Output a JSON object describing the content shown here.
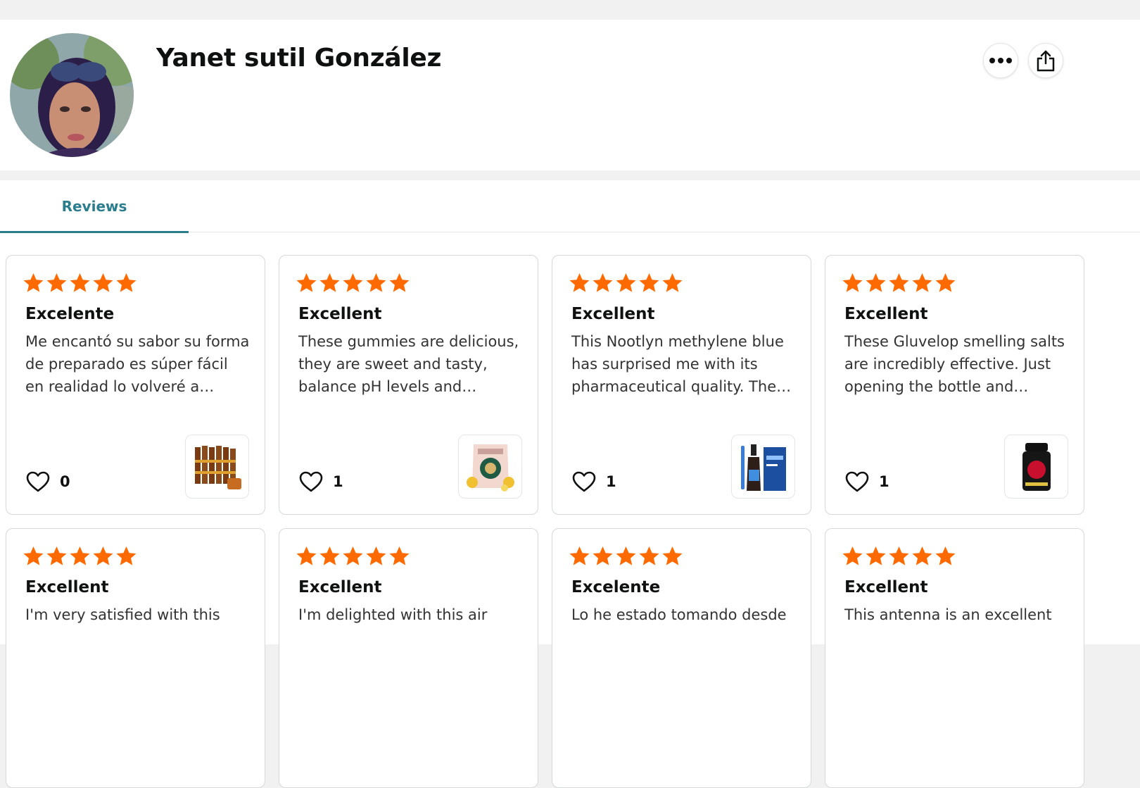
{
  "profile": {
    "name": "Yanet sutil González"
  },
  "tabs": [
    {
      "label": "Reviews"
    }
  ],
  "colors": {
    "accent": "#2a7d8c",
    "star": "#ff6a00"
  },
  "reviews": [
    {
      "rating": 5,
      "title": "Excelente",
      "body": "Me encantó su sabor su forma de preparado es súper fácil en realidad lo volveré a comprar",
      "likes": "0",
      "product_icon": "packets-box-image"
    },
    {
      "rating": 5,
      "title": "Excellent",
      "body": "These gummies are delicious, they are sweet and tasty, balance pH levels and…",
      "likes": "1",
      "product_icon": "gummies-pouch-image"
    },
    {
      "rating": 5,
      "title": "Excellent",
      "body": "This Nootlyn methylene blue has surprised me with its pharmaceutical quality. The…",
      "likes": "1",
      "product_icon": "dropper-bottle-image"
    },
    {
      "rating": 5,
      "title": "Excellent",
      "body": "These Gluvelop smelling salts are incredibly effective. Just opening the bottle and…",
      "likes": "1",
      "product_icon": "smelling-salts-bottle-image"
    },
    {
      "rating": 5,
      "title": "Excellent",
      "body": "I'm very satisfied with this"
    },
    {
      "rating": 5,
      "title": "Excellent",
      "body": "I'm delighted with this air"
    },
    {
      "rating": 5,
      "title": "Excelente",
      "body": "Lo he estado tomando desde"
    },
    {
      "rating": 5,
      "title": "Excellent",
      "body": "This antenna is an excellent"
    }
  ]
}
